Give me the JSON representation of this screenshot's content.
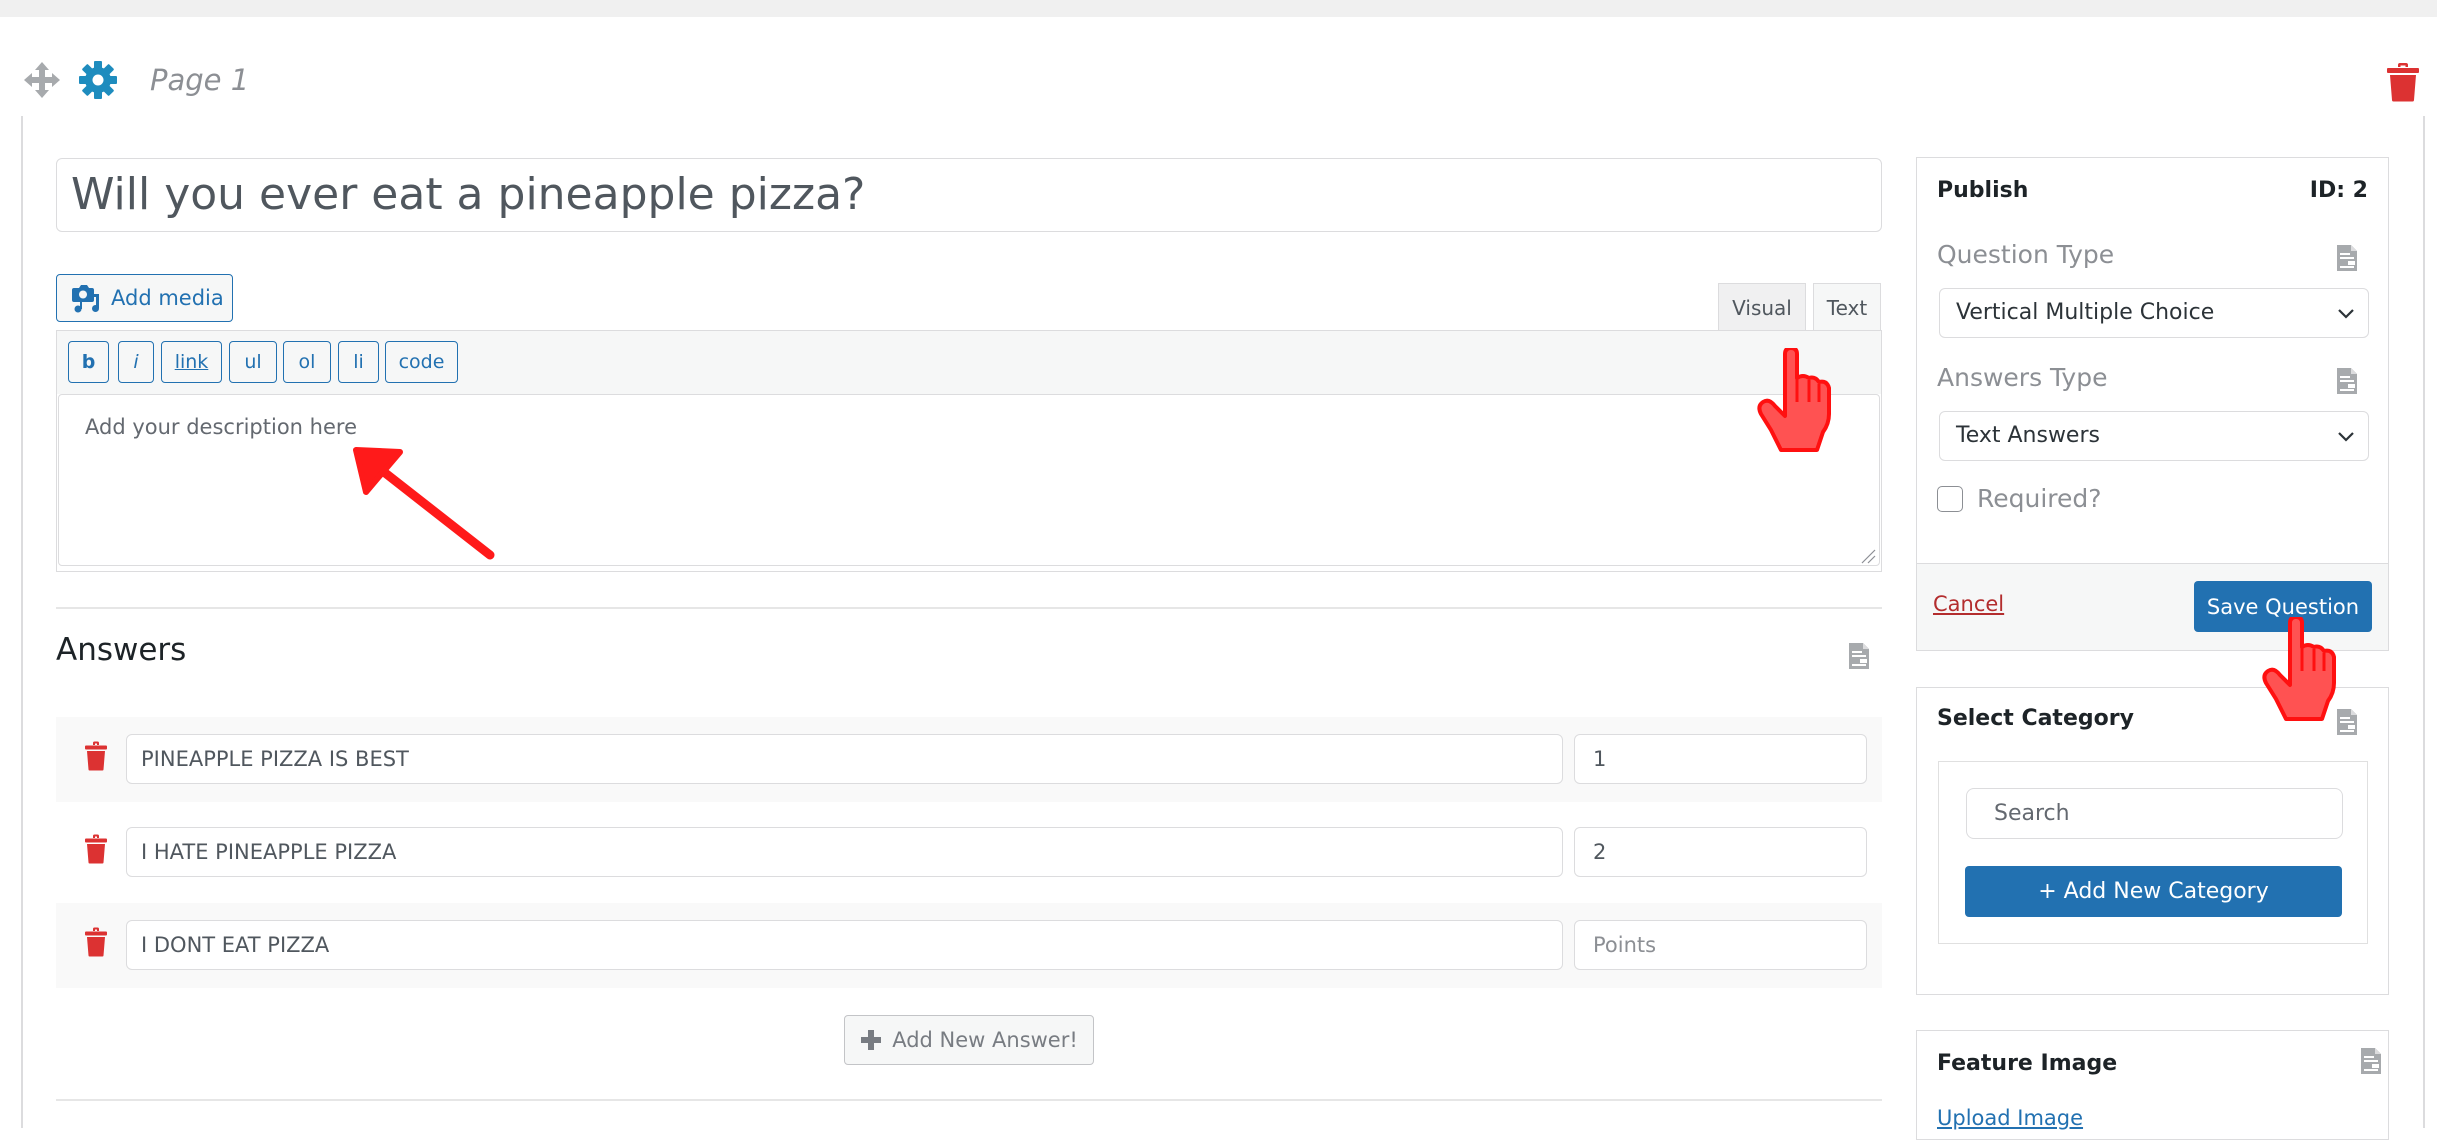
{
  "header": {
    "page_label": "Page 1",
    "icons": [
      "move-icon",
      "gear-icon",
      "trash-icon"
    ]
  },
  "question": {
    "title": "Will you ever eat a pineapple pizza?"
  },
  "editor": {
    "add_media_label": "Add media",
    "tabs": [
      {
        "label": "Visual",
        "active": false
      },
      {
        "label": "Text",
        "active": true
      }
    ],
    "toolbar_buttons": [
      "b",
      "i",
      "link",
      "ul",
      "ol",
      "li",
      "code"
    ],
    "description_placeholder": "Add your description here"
  },
  "answers": {
    "heading": "Answers",
    "rows": [
      {
        "text": "PINEAPPLE PIZZA IS BEST",
        "points": "1",
        "points_placeholder": "Points"
      },
      {
        "text": "I HATE PINEAPPLE PIZZA",
        "points": "2",
        "points_placeholder": "Points"
      },
      {
        "text": "I DONT EAT PIZZA",
        "points": "",
        "points_placeholder": "Points"
      }
    ],
    "add_button_label": "Add New Answer!"
  },
  "sidebar": {
    "publish": {
      "title": "Publish",
      "id_label": "ID: 2",
      "question_type_label": "Question Type",
      "question_type_value": "Vertical Multiple Choice",
      "answers_type_label": "Answers Type",
      "answers_type_value": "Text Answers",
      "required_label": "Required?",
      "required_checked": false,
      "cancel_label": "Cancel",
      "save_label": "Save Question"
    },
    "category": {
      "title": "Select Category",
      "search_placeholder": "Search",
      "add_label": "+ Add New Category"
    },
    "feature_image": {
      "title": "Feature Image",
      "upload_label": "Upload Image"
    }
  },
  "colors": {
    "accent": "#2271b1",
    "gear": "#1e8cbe",
    "danger": "#dc3232",
    "annotation": "#ff1a1a"
  }
}
